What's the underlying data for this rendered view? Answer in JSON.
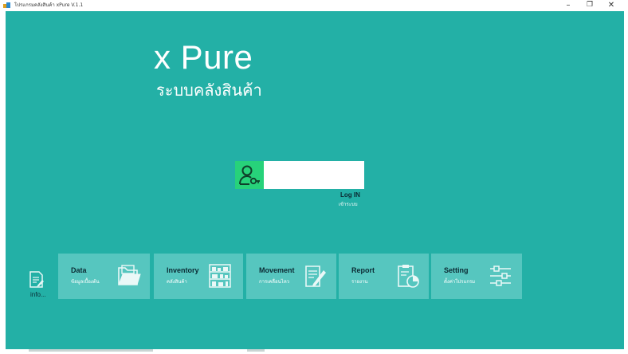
{
  "window": {
    "title": "โปรแกรมคลังสินค้า xPure V.1.1",
    "minimize": "–",
    "maximize": "❐",
    "close": "✕"
  },
  "brand": {
    "title": "x Pure",
    "subtitle": "ระบบคลังสินค้า"
  },
  "login": {
    "icon": "user-key-icon",
    "input_value": "",
    "label": "Log IN",
    "sublabel": "เข้าระบบ"
  },
  "info": {
    "icon": "document-edit-icon",
    "label": "info..."
  },
  "menu": [
    {
      "title": "Data",
      "subtitle": "ข้อมูลเบื้องต้น",
      "icon": "folder-icon"
    },
    {
      "title": "Inventory",
      "subtitle": "คลังสินค้า",
      "icon": "warehouse-shelf-icon"
    },
    {
      "title": "Movement",
      "subtitle": "การเคลื่อนไหว",
      "icon": "edit-document-icon"
    },
    {
      "title": "Report",
      "subtitle": "รายงาน",
      "icon": "report-chart-icon"
    },
    {
      "title": "Setting",
      "subtitle": "ตั้งค่าโปรแกรม",
      "icon": "sliders-icon"
    }
  ],
  "colors": {
    "background": "#23b0a6",
    "tile": "#56c6bf",
    "login_icon_bg": "#27d27a"
  }
}
